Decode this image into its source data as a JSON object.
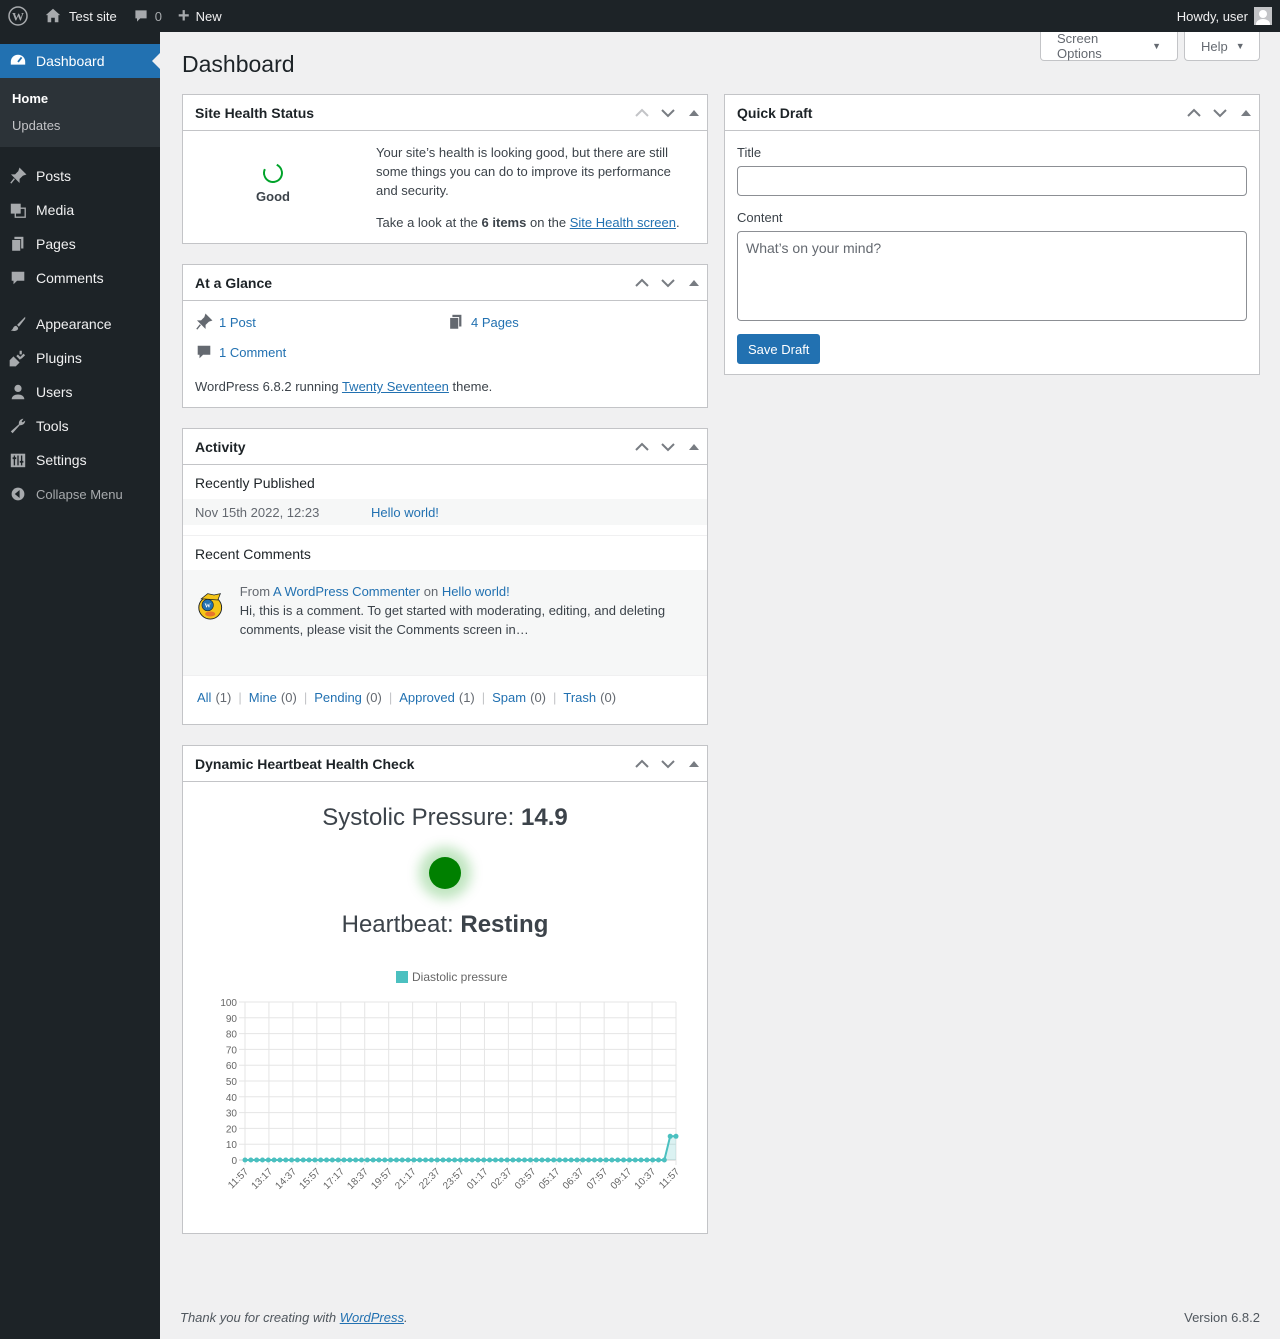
{
  "adminbar": {
    "site_name": "Test site",
    "comments_count": "0",
    "new_label": "New",
    "howdy": "Howdy, user"
  },
  "sidebar": {
    "dashboard": "Dashboard",
    "submenu": [
      "Home",
      "Updates"
    ],
    "items": [
      "Posts",
      "Media",
      "Pages",
      "Comments",
      "Appearance",
      "Plugins",
      "Users",
      "Tools",
      "Settings"
    ],
    "collapse": "Collapse Menu"
  },
  "screen_options": "Screen Options",
  "help": "Help",
  "page_title": "Dashboard",
  "site_health": {
    "title": "Site Health Status",
    "status": "Good",
    "text": "Your site’s health is looking good, but there are still some things you can do to improve its performance and security.",
    "take_look": "Take a look at the",
    "items": "6 items",
    "on_the": "on the",
    "link": "Site Health screen",
    "period": "."
  },
  "at_a_glance": {
    "title": "At a Glance",
    "posts": "1 Post",
    "pages": "4 Pages",
    "comments": "1 Comment",
    "wp_prefix": "WordPress 6.8.2 running",
    "theme": "Twenty Seventeen",
    "wp_suffix": "theme."
  },
  "activity": {
    "title": "Activity",
    "recently_published": "Recently Published",
    "pub_date": "Nov 15th 2022, 12:23",
    "pub_title": "Hello world!",
    "recent_comments": "Recent Comments",
    "from": "From",
    "commenter": "A WordPress Commenter",
    "on": "on",
    "comment_post": "Hello world!",
    "comment_text": "Hi, this is a comment. To get started with moderating, editing, and deleting comments, please visit the Comments screen in…",
    "filters": [
      {
        "label": "All",
        "count": "(1)"
      },
      {
        "label": "Mine",
        "count": "(0)"
      },
      {
        "label": "Pending",
        "count": "(0)"
      },
      {
        "label": "Approved",
        "count": "(1)"
      },
      {
        "label": "Spam",
        "count": "(0)"
      },
      {
        "label": "Trash",
        "count": "(0)"
      }
    ]
  },
  "heartbeat": {
    "title": "Dynamic Heartbeat Health Check",
    "systolic_label": "Systolic Pressure:",
    "systolic_value": "14.9",
    "heartbeat_label": "Heartbeat:",
    "heartbeat_value": "Resting",
    "dot_color": "#008000"
  },
  "quick_draft": {
    "title": "Quick Draft",
    "title_label": "Title",
    "content_label": "Content",
    "placeholder": "What’s on your mind?",
    "save": "Save Draft"
  },
  "footer": {
    "thanks": "Thank you for creating with",
    "wp_link": "WordPress",
    "period": ".",
    "version": "Version 6.8.2"
  },
  "chart_data": {
    "type": "line",
    "series": [
      {
        "name": "Diastolic pressure",
        "color": "#4bc0c0",
        "values": [
          0,
          0,
          0,
          0,
          0,
          0,
          0,
          0,
          0,
          0,
          0,
          0,
          0,
          0,
          0,
          0,
          0,
          0,
          0,
          0,
          0,
          0,
          0,
          0,
          0,
          0,
          0,
          0,
          0,
          0,
          0,
          0,
          0,
          0,
          0,
          0,
          0,
          0,
          0,
          0,
          0,
          0,
          0,
          0,
          0,
          0,
          0,
          0,
          0,
          0,
          0,
          0,
          0,
          0,
          0,
          0,
          0,
          0,
          0,
          0,
          0,
          0,
          0,
          0,
          0,
          0,
          0,
          0,
          0,
          0,
          0,
          0,
          0,
          15,
          15
        ]
      }
    ],
    "x_tick_labels": [
      "11:57",
      "13:17",
      "14:37",
      "15:57",
      "17:17",
      "18:37",
      "19:57",
      "21:17",
      "22:37",
      "23:57",
      "01:17",
      "02:37",
      "03:57",
      "05:17",
      "06:37",
      "07:57",
      "09:17",
      "10:37",
      "11:57"
    ],
    "y_ticks": [
      0,
      10,
      20,
      30,
      40,
      50,
      60,
      70,
      80,
      90,
      100
    ],
    "ylim": [
      0,
      100
    ],
    "grid": true,
    "legend": "top"
  }
}
